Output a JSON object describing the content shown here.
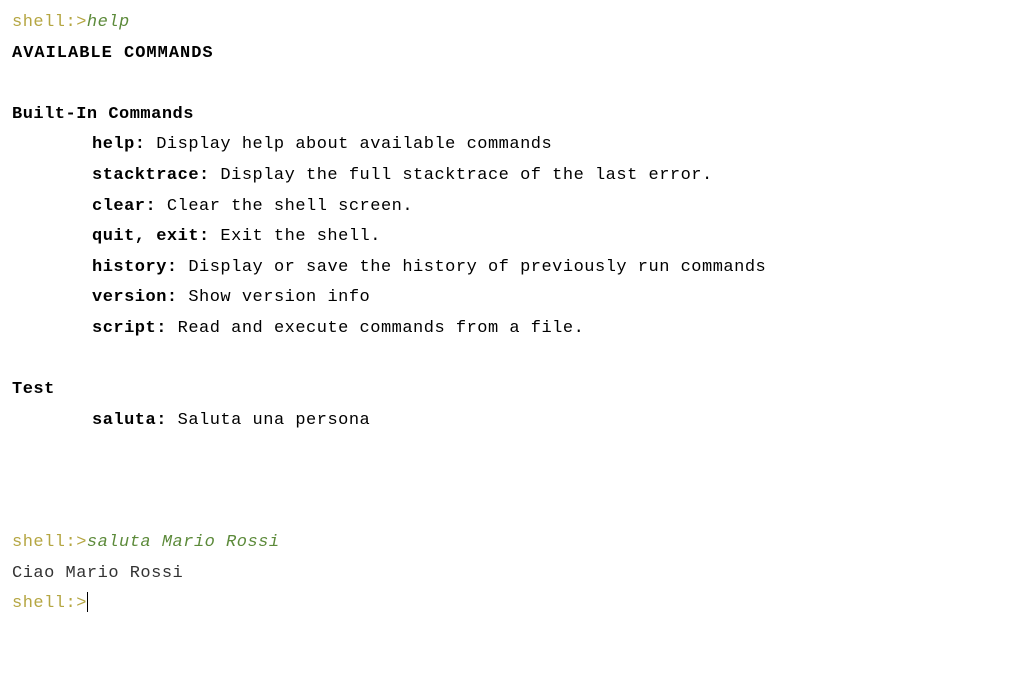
{
  "prompt": "shell:>",
  "entries": [
    {
      "command": "help",
      "output": {
        "heading": "AVAILABLE COMMANDS",
        "groups": [
          {
            "title": "Built-In Commands",
            "commands": [
              {
                "names": "help:",
                "desc": " Display help about available commands"
              },
              {
                "names": "stacktrace:",
                "desc": " Display the full stacktrace of the last error."
              },
              {
                "names": "clear:",
                "desc": " Clear the shell screen."
              },
              {
                "names": "quit, exit:",
                "desc": " Exit the shell."
              },
              {
                "names": "history:",
                "desc": " Display or save the history of previously run commands"
              },
              {
                "names": "version:",
                "desc": " Show version info"
              },
              {
                "names": "script:",
                "desc": " Read and execute commands from a file."
              }
            ]
          },
          {
            "title": "Test",
            "commands": [
              {
                "names": "saluta:",
                "desc": " Saluta una persona"
              }
            ]
          }
        ]
      }
    },
    {
      "command": "saluta Mario Rossi",
      "output_text": "Ciao Mario Rossi"
    }
  ]
}
